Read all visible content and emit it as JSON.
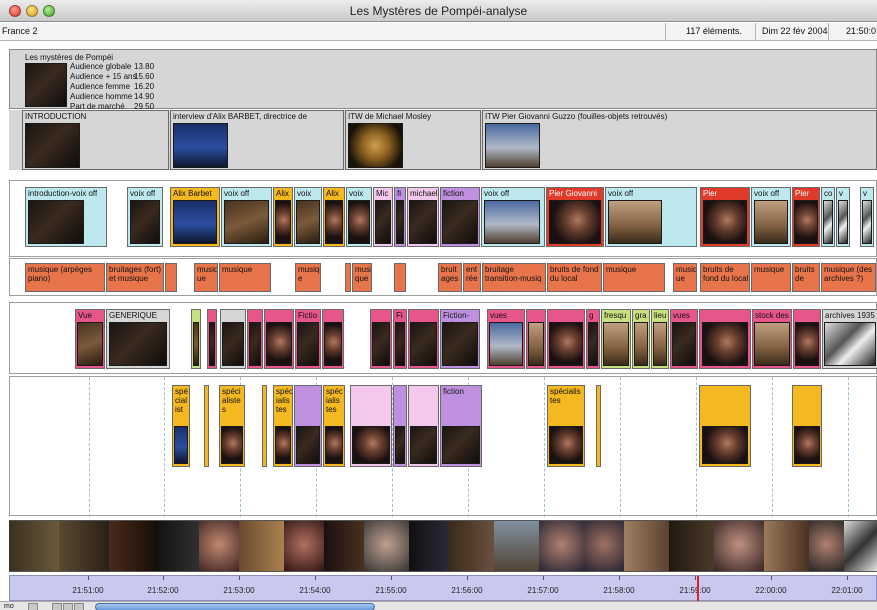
{
  "window": {
    "title": "Les Mystères de Pompéi-analyse"
  },
  "infobar": {
    "channel": "France 2",
    "element_count": "117 éléments.",
    "date": "Dim 22 fév 2004",
    "time": "21:50:0"
  },
  "program": {
    "title": "Les mystères de Pompéi",
    "audience": [
      {
        "label": "Audience globale",
        "value": "13.80"
      },
      {
        "label": "Audience + 15 ans",
        "value": "15.60"
      },
      {
        "label": "Audience femme",
        "value": "16.20"
      },
      {
        "label": "Audience homme",
        "value": "14.90"
      },
      {
        "label": "Part de marché",
        "value": "29.50"
      }
    ]
  },
  "sequences": [
    {
      "label": "INTRODUCTION"
    },
    {
      "label": "interview d'Alix BARBET, directrice de"
    },
    {
      "label": "ITW de Michael Mosley"
    },
    {
      "label": "ITW Pier Giovanni Guzzo (fouilles-objets retrouvés)"
    }
  ],
  "track_voice": [
    {
      "label": "introduction-voix off"
    },
    {
      "label": "voix off"
    },
    {
      "label": "Alix Barbet"
    },
    {
      "label": "voix off"
    },
    {
      "label": "Alix"
    },
    {
      "label": "voix"
    },
    {
      "label": "Alix"
    },
    {
      "label": "voix"
    },
    {
      "label": "Mic"
    },
    {
      "label": "fi"
    },
    {
      "label": "michael"
    },
    {
      "label": "fiction"
    },
    {
      "label": "voix off"
    },
    {
      "label": "Pier Giovanni"
    },
    {
      "label": "voix off"
    },
    {
      "label": "Pier"
    },
    {
      "label": "voix off"
    },
    {
      "label": "Pier"
    },
    {
      "label": "co"
    },
    {
      "label": "v"
    },
    {
      "label": "v"
    }
  ],
  "track_sound": [
    {
      "label": "musique (arpèges piano)"
    },
    {
      "label": "bruitages (fort) et musique"
    },
    {
      "label": "musiq ue"
    },
    {
      "label": "musique"
    },
    {
      "label": "musiqu e"
    },
    {
      "label": "musi que"
    },
    {
      "label": "bruit ages"
    },
    {
      "label": "ent rée"
    },
    {
      "label": "bruitage transition-musiq"
    },
    {
      "label": "bruits de fond du local"
    },
    {
      "label": "musique"
    },
    {
      "label": "musiq ue"
    },
    {
      "label": "bruits de fond du local"
    },
    {
      "label": "musique"
    },
    {
      "label": "bruits de"
    },
    {
      "label": "musique (des archives ?)"
    }
  ],
  "track_image": [
    {
      "label": "Vue"
    },
    {
      "label": "GENERIQUE"
    },
    {
      "label": "Fictio"
    },
    {
      "label": "Fi"
    },
    {
      "label": "Fiction-act"
    },
    {
      "label": "vues"
    },
    {
      "label": "g"
    },
    {
      "label": "fresqu"
    },
    {
      "label": "gra"
    },
    {
      "label": "lieu"
    },
    {
      "label": "vues"
    },
    {
      "label": "stock des"
    },
    {
      "label": "archives 1935"
    }
  ],
  "track_extra": [
    {
      "label": "spé cial ist"
    },
    {
      "label": "spéci aliste s"
    },
    {
      "label": "spéc ialis tes"
    },
    {
      "label": "spéc ialis tes"
    },
    {
      "label": "fiction"
    },
    {
      "label": "spécialis tes"
    }
  ],
  "timeline": {
    "ticks": [
      "21:51:00",
      "21:52:00",
      "21:53:00",
      "21:54:00",
      "21:55:00",
      "21:56:00",
      "21:57:00",
      "21:58:00",
      "21:59:00",
      "22:00:00",
      "22:01:00"
    ]
  },
  "bottombar": {
    "mode": "mo"
  },
  "colors": {
    "voice": "#bde8ee",
    "alix": "#f4b820",
    "pier": "#e03a2a",
    "sound": "#e8744c",
    "image": "#e8558a",
    "extra": "#f4b820",
    "fiction": "#c090e0",
    "lightpink": "#f4c8ec",
    "program_band": "#d6d6d6",
    "ruler": "#c9c9ef"
  }
}
